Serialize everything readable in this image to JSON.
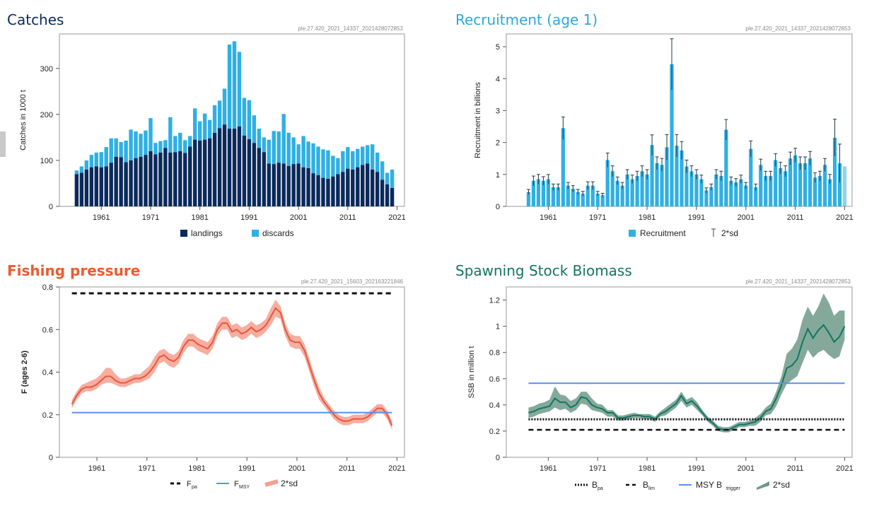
{
  "panels": {
    "catches": {
      "title": "Catches",
      "stamp": "ple.27.420_2021_14337_2021428072853"
    },
    "recruitment": {
      "title": "Recruitment (age 1)",
      "stamp": "ple.27.420_2021_14337_2021428072853"
    },
    "fishing": {
      "title": "Fishing pressure",
      "stamp": "ple.27.420_2021_15603_202163221846"
    },
    "ssb": {
      "title": "Spawning Stock Biomass",
      "stamp": "ple.27.420_2021_14337_2021428072853"
    }
  },
  "colors": {
    "landings": "#0b2a5b",
    "discards": "#2fb0e3",
    "recruitment": "#2fb0e3",
    "fishing_line": "#e8573b",
    "fishing_band": "#f4a090",
    "fmsy": "#5b8ff0",
    "ssb_line": "#137563",
    "ssb_band": "#6e9a88",
    "msy_btrigger": "#5b8ff0"
  },
  "chart_data": [
    {
      "id": "catches",
      "type": "bar",
      "stacked": true,
      "title": "Catches",
      "xlabel": "",
      "ylabel": "Catches in 1000 t",
      "x": [
        1956,
        1957,
        1958,
        1959,
        1960,
        1961,
        1962,
        1963,
        1964,
        1965,
        1966,
        1967,
        1968,
        1969,
        1970,
        1971,
        1972,
        1973,
        1974,
        1975,
        1976,
        1977,
        1978,
        1979,
        1980,
        1981,
        1982,
        1983,
        1984,
        1985,
        1986,
        1987,
        1988,
        1989,
        1990,
        1991,
        1992,
        1993,
        1994,
        1995,
        1996,
        1997,
        1998,
        1999,
        2000,
        2001,
        2002,
        2003,
        2004,
        2005,
        2006,
        2007,
        2008,
        2009,
        2010,
        2011,
        2012,
        2013,
        2014,
        2015,
        2016,
        2017,
        2018,
        2019,
        2020
      ],
      "xticks": [
        1961,
        1971,
        1981,
        1991,
        2001,
        2011,
        2021
      ],
      "ylim": [
        0,
        375
      ],
      "yticks": [
        0,
        100,
        200,
        300
      ],
      "series": [
        {
          "name": "landings",
          "values": [
            70,
            73,
            80,
            85,
            87,
            85,
            87,
            95,
            108,
            107,
            96,
            100,
            105,
            108,
            112,
            120,
            113,
            117,
            127,
            117,
            118,
            120,
            116,
            130,
            145,
            143,
            145,
            148,
            160,
            170,
            178,
            169,
            169,
            174,
            154,
            146,
            138,
            127,
            118,
            93,
            92,
            95,
            93,
            88,
            92,
            93,
            85,
            83,
            72,
            68,
            62,
            60,
            65,
            70,
            75,
            82,
            80,
            85,
            90,
            93,
            80,
            75,
            58,
            48,
            40
          ]
        },
        {
          "name": "discards",
          "values": [
            8,
            14,
            20,
            27,
            30,
            33,
            42,
            53,
            40,
            33,
            47,
            67,
            58,
            50,
            53,
            72,
            25,
            25,
            17,
            77,
            35,
            40,
            28,
            23,
            68,
            42,
            57,
            40,
            60,
            60,
            78,
            183,
            190,
            162,
            82,
            85,
            60,
            42,
            32,
            52,
            72,
            68,
            108,
            72,
            58,
            42,
            68,
            58,
            65,
            62,
            62,
            62,
            45,
            35,
            45,
            47,
            40,
            40,
            40,
            40,
            55,
            42,
            40,
            25,
            40
          ]
        }
      ],
      "legend": "bottom"
    },
    {
      "id": "recruitment",
      "type": "bar",
      "title": "Recruitment (age 1)",
      "xlabel": "",
      "ylabel": "Recruitment in billions",
      "x": [
        1957,
        1958,
        1959,
        1960,
        1961,
        1962,
        1963,
        1964,
        1965,
        1966,
        1967,
        1968,
        1969,
        1970,
        1971,
        1972,
        1973,
        1974,
        1975,
        1976,
        1977,
        1978,
        1979,
        1980,
        1981,
        1982,
        1983,
        1984,
        1985,
        1986,
        1987,
        1988,
        1989,
        1990,
        1991,
        1992,
        1993,
        1994,
        1995,
        1996,
        1997,
        1998,
        1999,
        2000,
        2001,
        2002,
        2003,
        2004,
        2005,
        2006,
        2007,
        2008,
        2009,
        2010,
        2011,
        2012,
        2013,
        2014,
        2015,
        2016,
        2017,
        2018,
        2019,
        2020,
        2021
      ],
      "values": [
        0.45,
        0.8,
        0.85,
        0.8,
        0.85,
        0.6,
        0.6,
        2.45,
        0.65,
        0.55,
        0.45,
        0.4,
        0.65,
        0.65,
        0.4,
        0.35,
        1.45,
        1.1,
        0.8,
        0.65,
        1.0,
        0.85,
        0.95,
        1.1,
        1.0,
        1.92,
        1.35,
        1.3,
        1.85,
        4.45,
        1.9,
        1.75,
        1.25,
        1.1,
        1.0,
        0.85,
        0.5,
        0.6,
        1.0,
        0.95,
        2.4,
        0.8,
        0.75,
        0.85,
        0.65,
        1.8,
        0.6,
        1.3,
        0.95,
        0.95,
        1.45,
        1.2,
        1.1,
        1.5,
        1.6,
        1.35,
        1.35,
        1.5,
        0.9,
        0.95,
        1.3,
        0.85,
        2.15,
        1.35,
        1.25
      ],
      "errors": [
        0.08,
        0.15,
        0.15,
        0.13,
        0.15,
        0.1,
        0.1,
        0.35,
        0.1,
        0.1,
        0.08,
        0.07,
        0.12,
        0.12,
        0.07,
        0.06,
        0.22,
        0.17,
        0.12,
        0.1,
        0.15,
        0.13,
        0.15,
        0.17,
        0.15,
        0.32,
        0.2,
        0.2,
        0.4,
        0.8,
        0.35,
        0.28,
        0.2,
        0.17,
        0.15,
        0.13,
        0.08,
        0.1,
        0.15,
        0.15,
        0.32,
        0.12,
        0.12,
        0.13,
        0.1,
        0.25,
        0.1,
        0.18,
        0.15,
        0.15,
        0.2,
        0.18,
        0.17,
        0.2,
        0.22,
        0.2,
        0.2,
        0.22,
        0.15,
        0.15,
        0.2,
        0.15,
        0.58,
        0.6,
        0
      ],
      "xticks": [
        1961,
        1971,
        1981,
        1991,
        2001,
        2011,
        2021
      ],
      "ylim": [
        0,
        5.4
      ],
      "yticks": [
        0,
        1,
        2,
        3,
        4,
        5
      ],
      "legend_items": [
        "Recruitment",
        "2*sd"
      ],
      "legend": "bottom"
    },
    {
      "id": "fishing",
      "type": "area",
      "title": "Fishing pressure",
      "xlabel": "",
      "ylabel": "F (ages 2-6)",
      "x": [
        1956,
        1957,
        1958,
        1959,
        1960,
        1961,
        1962,
        1963,
        1964,
        1965,
        1966,
        1967,
        1968,
        1969,
        1970,
        1971,
        1972,
        1973,
        1974,
        1975,
        1976,
        1977,
        1978,
        1979,
        1980,
        1981,
        1982,
        1983,
        1984,
        1985,
        1986,
        1987,
        1988,
        1989,
        1990,
        1991,
        1992,
        1993,
        1994,
        1995,
        1996,
        1997,
        1998,
        1999,
        2000,
        2001,
        2002,
        2003,
        2004,
        2005,
        2006,
        2007,
        2008,
        2009,
        2010,
        2011,
        2012,
        2013,
        2014,
        2015,
        2016,
        2017,
        2018,
        2019,
        2020
      ],
      "series": [
        {
          "name": "F",
          "values": [
            0.25,
            0.29,
            0.32,
            0.33,
            0.33,
            0.34,
            0.36,
            0.38,
            0.38,
            0.36,
            0.35,
            0.35,
            0.36,
            0.37,
            0.37,
            0.38,
            0.4,
            0.43,
            0.47,
            0.48,
            0.46,
            0.45,
            0.47,
            0.52,
            0.55,
            0.55,
            0.53,
            0.52,
            0.51,
            0.54,
            0.6,
            0.63,
            0.63,
            0.59,
            0.6,
            0.58,
            0.59,
            0.61,
            0.59,
            0.6,
            0.62,
            0.66,
            0.7,
            0.68,
            0.6,
            0.55,
            0.54,
            0.54,
            0.5,
            0.43,
            0.36,
            0.3,
            0.26,
            0.23,
            0.2,
            0.18,
            0.17,
            0.17,
            0.18,
            0.18,
            0.18,
            0.19,
            0.21,
            0.23,
            0.23,
            0.2,
            0.15
          ]
        },
        {
          "name": "2*sd upper",
          "values": [
            0.27,
            0.31,
            0.34,
            0.35,
            0.36,
            0.37,
            0.39,
            0.42,
            0.42,
            0.39,
            0.37,
            0.37,
            0.38,
            0.39,
            0.39,
            0.41,
            0.43,
            0.47,
            0.5,
            0.51,
            0.49,
            0.48,
            0.5,
            0.55,
            0.58,
            0.58,
            0.56,
            0.55,
            0.54,
            0.57,
            0.63,
            0.66,
            0.66,
            0.62,
            0.63,
            0.61,
            0.62,
            0.64,
            0.62,
            0.63,
            0.65,
            0.7,
            0.74,
            0.71,
            0.63,
            0.58,
            0.57,
            0.57,
            0.53,
            0.46,
            0.39,
            0.33,
            0.28,
            0.25,
            0.22,
            0.2,
            0.19,
            0.19,
            0.2,
            0.2,
            0.2,
            0.21,
            0.23,
            0.25,
            0.25,
            0.22,
            0.17
          ]
        },
        {
          "name": "2*sd lower",
          "values": [
            0.23,
            0.27,
            0.3,
            0.31,
            0.31,
            0.32,
            0.34,
            0.35,
            0.35,
            0.34,
            0.33,
            0.33,
            0.34,
            0.35,
            0.35,
            0.36,
            0.37,
            0.4,
            0.44,
            0.45,
            0.43,
            0.42,
            0.44,
            0.49,
            0.52,
            0.52,
            0.5,
            0.49,
            0.48,
            0.51,
            0.57,
            0.6,
            0.6,
            0.56,
            0.57,
            0.55,
            0.56,
            0.58,
            0.56,
            0.57,
            0.59,
            0.62,
            0.66,
            0.65,
            0.57,
            0.52,
            0.51,
            0.51,
            0.47,
            0.4,
            0.33,
            0.27,
            0.24,
            0.21,
            0.18,
            0.16,
            0.15,
            0.15,
            0.16,
            0.16,
            0.16,
            0.17,
            0.19,
            0.21,
            0.21,
            0.18,
            0.13
          ]
        }
      ],
      "reference_lines": [
        {
          "name": "Fpa",
          "value": 0.77,
          "style": "dashed"
        },
        {
          "name": "FMSY",
          "value": 0.21,
          "style": "solid"
        }
      ],
      "xticks": [
        1961,
        1971,
        1981,
        1991,
        2001,
        2011,
        2021
      ],
      "ylim": [
        0,
        0.8
      ],
      "yticks": [
        0,
        0.2,
        0.4,
        0.6,
        0.8
      ],
      "legend_items": [
        "F",
        "pa",
        "F",
        "MSY",
        "2*sd"
      ],
      "legend": "bottom"
    },
    {
      "id": "ssb",
      "type": "area",
      "title": "Spawning Stock Biomass",
      "xlabel": "",
      "ylabel": "SSB in million t",
      "x": [
        1957,
        1958,
        1959,
        1960,
        1961,
        1962,
        1963,
        1964,
        1965,
        1966,
        1967,
        1968,
        1969,
        1970,
        1971,
        1972,
        1973,
        1974,
        1975,
        1976,
        1977,
        1978,
        1979,
        1980,
        1981,
        1982,
        1983,
        1984,
        1985,
        1986,
        1987,
        1988,
        1989,
        1990,
        1991,
        1992,
        1993,
        1994,
        1995,
        1996,
        1997,
        1998,
        1999,
        2000,
        2001,
        2002,
        2003,
        2004,
        2005,
        2006,
        2007,
        2008,
        2009,
        2010,
        2011,
        2012,
        2013,
        2014,
        2015,
        2016,
        2017,
        2018,
        2019,
        2020,
        2021
      ],
      "series": [
        {
          "name": "SSB",
          "values": [
            0.34,
            0.35,
            0.37,
            0.38,
            0.39,
            0.45,
            0.42,
            0.42,
            0.38,
            0.4,
            0.46,
            0.45,
            0.4,
            0.38,
            0.37,
            0.34,
            0.34,
            0.3,
            0.3,
            0.31,
            0.32,
            0.32,
            0.31,
            0.31,
            0.29,
            0.33,
            0.35,
            0.38,
            0.41,
            0.47,
            0.41,
            0.43,
            0.39,
            0.34,
            0.29,
            0.26,
            0.22,
            0.21,
            0.21,
            0.23,
            0.25,
            0.25,
            0.26,
            0.27,
            0.3,
            0.35,
            0.37,
            0.45,
            0.55,
            0.68,
            0.7,
            0.75,
            0.88,
            0.98,
            0.91,
            0.97,
            1.01,
            0.95,
            0.88,
            0.92,
            1.0
          ]
        },
        {
          "name": "2*sd upper",
          "values": [
            0.38,
            0.39,
            0.41,
            0.42,
            0.44,
            0.54,
            0.48,
            0.47,
            0.43,
            0.45,
            0.5,
            0.5,
            0.45,
            0.41,
            0.4,
            0.36,
            0.36,
            0.32,
            0.32,
            0.33,
            0.34,
            0.33,
            0.33,
            0.33,
            0.31,
            0.35,
            0.38,
            0.41,
            0.44,
            0.5,
            0.44,
            0.46,
            0.42,
            0.36,
            0.31,
            0.28,
            0.24,
            0.23,
            0.23,
            0.25,
            0.27,
            0.27,
            0.28,
            0.3,
            0.33,
            0.38,
            0.41,
            0.5,
            0.62,
            0.79,
            0.83,
            0.9,
            1.05,
            1.15,
            1.08,
            1.15,
            1.25,
            1.18,
            1.08,
            1.12,
            1.12
          ]
        },
        {
          "name": "2*sd lower",
          "values": [
            0.3,
            0.31,
            0.33,
            0.34,
            0.35,
            0.38,
            0.36,
            0.37,
            0.34,
            0.36,
            0.41,
            0.4,
            0.36,
            0.35,
            0.34,
            0.31,
            0.31,
            0.28,
            0.28,
            0.29,
            0.3,
            0.3,
            0.29,
            0.29,
            0.27,
            0.31,
            0.32,
            0.35,
            0.38,
            0.43,
            0.38,
            0.4,
            0.36,
            0.32,
            0.27,
            0.24,
            0.2,
            0.19,
            0.19,
            0.21,
            0.23,
            0.23,
            0.24,
            0.24,
            0.27,
            0.32,
            0.33,
            0.39,
            0.48,
            0.56,
            0.59,
            0.62,
            0.72,
            0.82,
            0.76,
            0.8,
            0.82,
            0.78,
            0.75,
            0.77,
            0.9
          ]
        }
      ],
      "reference_lines": [
        {
          "name": "Bpa",
          "value": 0.29,
          "style": "dotted"
        },
        {
          "name": "Blim",
          "value": 0.21,
          "style": "dashed"
        },
        {
          "name": "MSY Btrigger",
          "value": 0.565,
          "style": "solid"
        }
      ],
      "xticks": [
        1961,
        1971,
        1981,
        1991,
        2001,
        2011,
        2021
      ],
      "ylim": [
        0,
        1.3
      ],
      "yticks": [
        0,
        0.2,
        0.4,
        0.6,
        0.8,
        1,
        1.2
      ],
      "legend_items": [
        "B",
        "pa",
        "B",
        "lim",
        "MSY B",
        "trigger",
        "2*sd"
      ],
      "legend": "bottom"
    }
  ]
}
